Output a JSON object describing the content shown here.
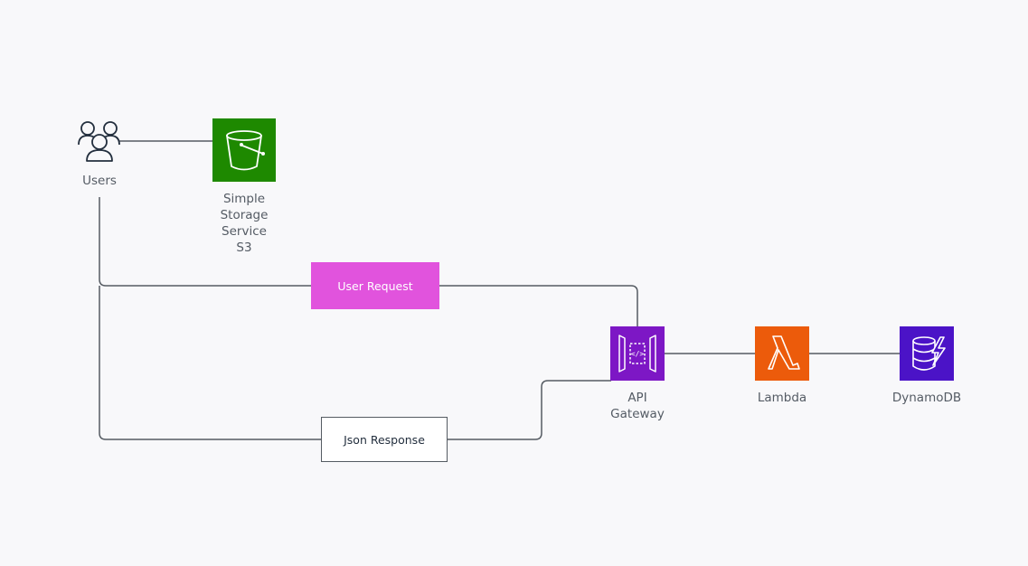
{
  "nodes": {
    "users": {
      "label": "Users",
      "icon": "users-icon"
    },
    "s3": {
      "label": "Simple\nStorage\nService\nS3",
      "icon": "s3-bucket-icon",
      "color": "#1e8900"
    },
    "api_gateway": {
      "label": "API\nGateway",
      "icon": "api-gateway-icon",
      "color": "#7d17c5"
    },
    "lambda": {
      "label": "Lambda",
      "icon": "lambda-icon",
      "color": "#ec5b0b"
    },
    "dynamodb": {
      "label": "DynamoDB",
      "icon": "dynamodb-icon",
      "color": "#4b13c7"
    }
  },
  "boxes": {
    "user_request": {
      "label": "User Request",
      "color": "#e153dd"
    },
    "json_response": {
      "label": "Json Response"
    }
  },
  "edges": [
    {
      "from": "users",
      "to": "s3"
    },
    {
      "from": "users",
      "to": "api_gateway",
      "via": "user_request"
    },
    {
      "from": "api_gateway",
      "to": "users",
      "via": "json_response"
    },
    {
      "from": "api_gateway",
      "to": "lambda"
    },
    {
      "from": "lambda",
      "to": "dynamodb"
    }
  ],
  "colors": {
    "connector": "#555b62",
    "label_text": "#545b64"
  }
}
